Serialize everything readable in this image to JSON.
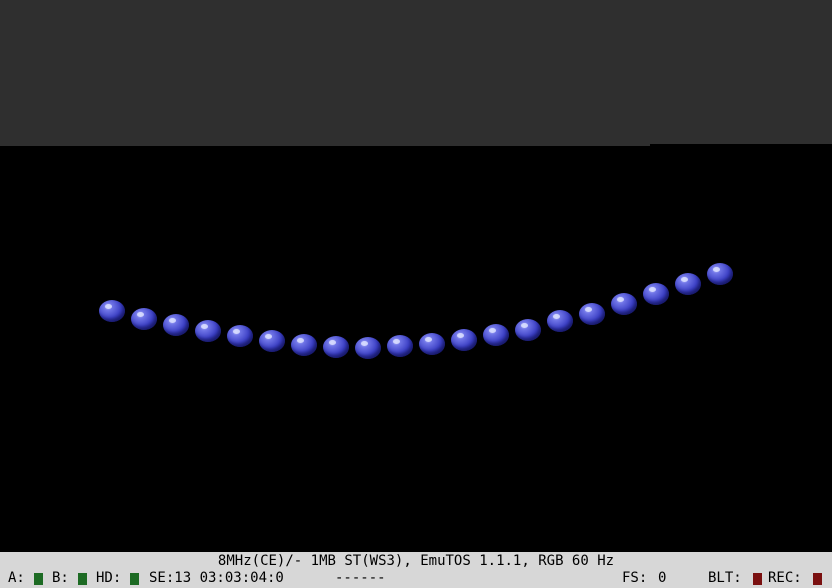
{
  "emulator": {
    "status_line": "8MHz(CE)/- 1MB ST(WS3), EmuTOS 1.1.1, RGB 60 Hz",
    "drive_a_label": "A:",
    "drive_b_label": "B:",
    "hd_label": "HD:",
    "sector_info": "SE:13 03:03:04:0",
    "activity": "------",
    "fs_label": "FS:",
    "fs_value": "0",
    "blt_label": "BLT:",
    "rec_label": "REC:"
  },
  "colors": {
    "border": "#2f2f2f",
    "screen_background": "#000000",
    "ball": "#3b3fc4",
    "status_bar": "#d7d7d7",
    "led_on_green": "#1d6b24",
    "led_on_red": "#7a1010"
  },
  "game": {
    "ball_count": 20
  }
}
